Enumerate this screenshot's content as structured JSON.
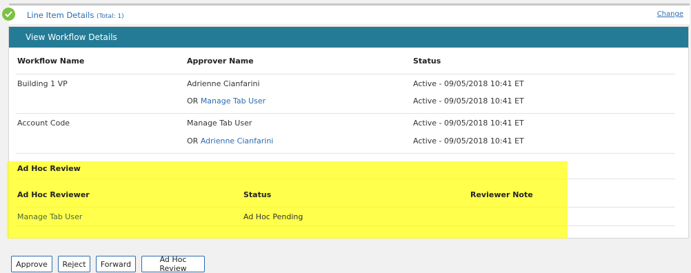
{
  "line_item": {
    "title": "Line Item Details",
    "total": "(Total: 1)",
    "change": "Change"
  },
  "workflow": {
    "header": "View Workflow Details",
    "columns": {
      "workflow_name": "Workflow Name",
      "approver_name": "Approver Name",
      "status": "Status"
    },
    "rows": [
      {
        "workflow": "Building 1 VP",
        "approver": "Adrienne Cianfarini",
        "status": "Active - 09/05/2018 10:41 ET",
        "alt_prefix": "OR",
        "alt_approver": "Manage Tab User",
        "alt_status": "Active - 09/05/2018 10:41 ET"
      },
      {
        "workflow": "Account Code",
        "approver": "Manage Tab User",
        "status": "Active - 09/05/2018 10:41 ET",
        "alt_prefix": "OR",
        "alt_approver": "Adrienne Cianfarini",
        "alt_status": "Active - 09/05/2018 10:41 ET"
      }
    ]
  },
  "adhoc": {
    "section_title": "Ad Hoc Review",
    "columns": {
      "reviewer": "Ad Hoc Reviewer",
      "status": "Status",
      "note": "Reviewer Note"
    },
    "rows": [
      {
        "reviewer": "Manage Tab User",
        "status": "Ad Hoc Pending",
        "note": ""
      }
    ]
  },
  "buttons": {
    "approve": "Approve",
    "reject": "Reject",
    "forward": "Forward",
    "adhoc_review": "Ad Hoc Review"
  },
  "colors": {
    "header_teal": "#247b96",
    "link_blue": "#2b6cb0",
    "check_green": "#7cc242",
    "highlight_yellow": "#ffff00"
  }
}
